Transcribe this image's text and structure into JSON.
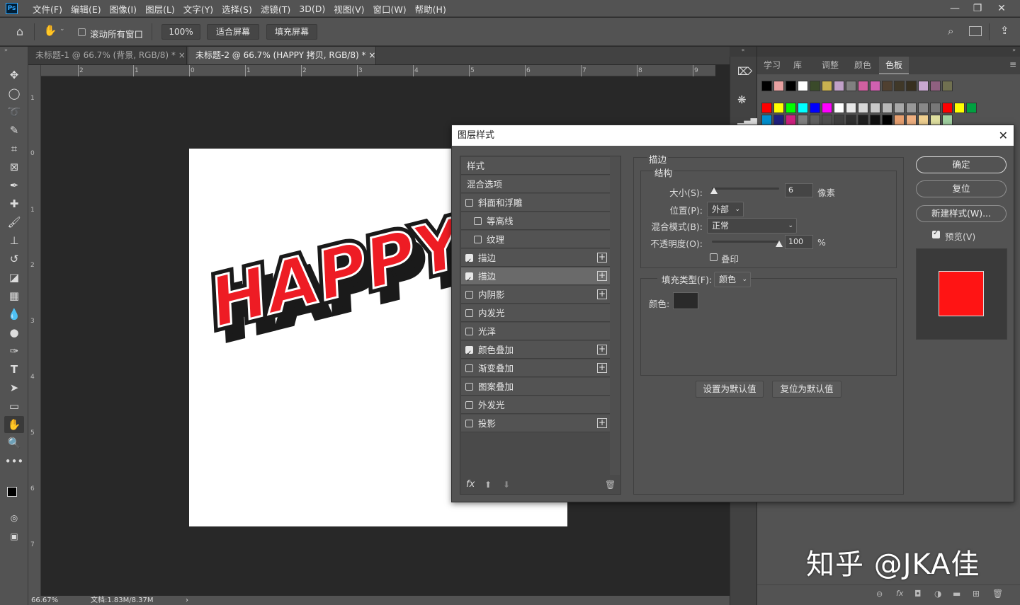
{
  "menubar": {
    "logo": "Ps",
    "items": [
      "文件(F)",
      "编辑(E)",
      "图像(I)",
      "图层(L)",
      "文字(Y)",
      "选择(S)",
      "滤镜(T)",
      "3D(D)",
      "视图(V)",
      "窗口(W)",
      "帮助(H)"
    ]
  },
  "options": {
    "scroll_all": "滚动所有窗口",
    "zoom": "100%",
    "fit_screen": "适合屏幕",
    "fill_screen": "填充屏幕"
  },
  "tabs": [
    {
      "label": "未标题-1 @ 66.7% (背景, RGB/8) *",
      "close": "×"
    },
    {
      "label": "未标题-2 @ 66.7% (HAPPY 拷贝, RGB/8) *",
      "close": "×"
    }
  ],
  "ruler_top": [
    "2",
    "1",
    "0",
    "1",
    "2",
    "3",
    "4",
    "5",
    "6",
    "7",
    "8",
    "9"
  ],
  "ruler_left": [
    "1",
    "0",
    "1",
    "2",
    "3",
    "4",
    "5",
    "6",
    "7"
  ],
  "canvas_text": "HAPPY",
  "status": {
    "zoom": "66.67%",
    "doc": "文档:1.83M/8.37M",
    "arrow": "›"
  },
  "right_panel": {
    "tabs": [
      "学习",
      "库",
      "调整",
      "颜色",
      "色板"
    ],
    "active_tab": "色板",
    "swatch_row1": [
      "#000000",
      "#e8a0a0",
      "#000000",
      "#ffffff",
      "#3a4a2a",
      "#c8b050",
      "#c0a0c8",
      "#808080",
      "#d060a0",
      "#d060b0",
      "#504030",
      "#403828",
      "#383020",
      "#c8a8d0",
      "#906080",
      "#707050"
    ],
    "swatch_row2": [
      "#ff0000",
      "#ffff00",
      "#00ff00",
      "#00ffff",
      "#0000ff",
      "#ff00ff",
      "#ffffff",
      "#e8e8e8",
      "#d8d8d8",
      "#c8c8c8",
      "#b8b8b8",
      "#a8a8a8",
      "#989898",
      "#888888",
      "#787878",
      "#ff0000",
      "#ffff00",
      "#00a040"
    ],
    "swatch_row3": [
      "#0090d0",
      "#202080",
      "#d02080",
      "#808080",
      "#606060",
      "#505050",
      "#404040",
      "#303030",
      "#202020",
      "#101010",
      "#000000",
      "#e8a070",
      "#f0b080",
      "#f0d090",
      "#e0e0a0",
      "#a0d0a0"
    ]
  },
  "dialog": {
    "title": "图层样式",
    "close": "✕",
    "style_list": [
      {
        "label": "样式",
        "type": "header"
      },
      {
        "label": "混合选项",
        "type": "header"
      },
      {
        "label": "斜面和浮雕",
        "checked": false,
        "plus": false,
        "indent": false
      },
      {
        "label": "等高线",
        "checked": false,
        "plus": false,
        "indent": true
      },
      {
        "label": "纹理",
        "checked": false,
        "plus": false,
        "indent": true
      },
      {
        "label": "描边",
        "checked": true,
        "plus": true,
        "indent": false
      },
      {
        "label": "描边",
        "checked": true,
        "plus": true,
        "indent": false,
        "highlight": true
      },
      {
        "label": "内阴影",
        "checked": false,
        "plus": true,
        "indent": false
      },
      {
        "label": "内发光",
        "checked": false,
        "plus": false,
        "indent": false
      },
      {
        "label": "光泽",
        "checked": false,
        "plus": false,
        "indent": false
      },
      {
        "label": "颜色叠加",
        "checked": true,
        "plus": true,
        "indent": false
      },
      {
        "label": "渐变叠加",
        "checked": false,
        "plus": true,
        "indent": false
      },
      {
        "label": "图案叠加",
        "checked": false,
        "plus": false,
        "indent": false
      },
      {
        "label": "外发光",
        "checked": false,
        "plus": false,
        "indent": false
      },
      {
        "label": "投影",
        "checked": false,
        "plus": true,
        "indent": false
      }
    ],
    "section_title": "描边",
    "structure_title": "结构",
    "size_label": "大小(S):",
    "size_value": "6",
    "size_unit": "像素",
    "position_label": "位置(P):",
    "position_value": "外部",
    "blend_label": "混合模式(B):",
    "blend_value": "正常",
    "opacity_label": "不透明度(O):",
    "opacity_value": "100",
    "opacity_unit": "%",
    "overprint_label": "叠印",
    "fill_type_label": "填充类型(F):",
    "fill_type_value": "颜色",
    "color_label": "颜色:",
    "stroke_color": "#2a2a2a",
    "set_default": "设置为默认值",
    "reset_default": "复位为默认值",
    "ok": "确定",
    "reset": "复位",
    "new_style": "新建样式(W)...",
    "preview": "预览(V)",
    "preview_color": "#ff1414",
    "footer_fx": "fx"
  },
  "watermark": "知乎 @JKA佳"
}
